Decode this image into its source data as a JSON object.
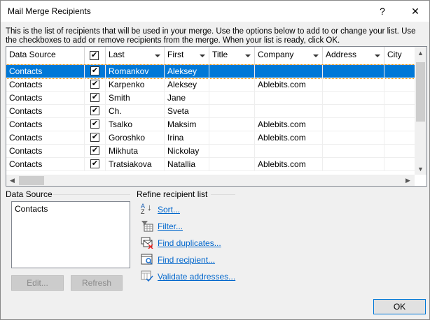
{
  "window": {
    "title": "Mail Merge Recipients",
    "help": "?",
    "close": "✕"
  },
  "intro": "This is the list of recipients that will be used in your merge.  Use the options below to add to or change your list.  Use the checkboxes to add or remove recipients from the merge.  When your list is ready, click OK.",
  "columns": [
    "Data Source",
    "",
    "Last",
    "First",
    "Title",
    "Company",
    "Address",
    "City"
  ],
  "rows": [
    {
      "source": "Contacts",
      "checked": true,
      "last": "Romankov",
      "first": "Aleksey",
      "title": "",
      "company": "",
      "selected": true
    },
    {
      "source": "Contacts",
      "checked": true,
      "last": "Karpenko",
      "first": "Aleksey",
      "title": "",
      "company": "Ablebits.com"
    },
    {
      "source": "Contacts",
      "checked": true,
      "last": "Smith",
      "first": "Jane",
      "title": "",
      "company": ""
    },
    {
      "source": "Contacts",
      "checked": true,
      "last": "Ch.",
      "first": "Sveta",
      "title": "",
      "company": ""
    },
    {
      "source": "Contacts",
      "checked": true,
      "last": "Tsalko",
      "first": "Maksim",
      "title": "",
      "company": "Ablebits.com"
    },
    {
      "source": "Contacts",
      "checked": true,
      "last": "Goroshko",
      "first": "Irina",
      "title": "",
      "company": "Ablebits.com"
    },
    {
      "source": "Contacts",
      "checked": true,
      "last": "Mikhuta",
      "first": "Nickolay",
      "title": "",
      "company": ""
    },
    {
      "source": "Contacts",
      "checked": true,
      "last": "Tratsiakova",
      "first": "Natallia",
      "title": "",
      "company": "Ablebits.com"
    }
  ],
  "data_source": {
    "label": "Data Source",
    "items": [
      "Contacts"
    ],
    "edit": "Edit...",
    "refresh": "Refresh"
  },
  "refine": {
    "label": "Refine recipient list",
    "sort": "Sort...",
    "filter": "Filter...",
    "dup": "Find duplicates...",
    "find": "Find recipient...",
    "validate": "Validate addresses..."
  },
  "ok": "OK"
}
